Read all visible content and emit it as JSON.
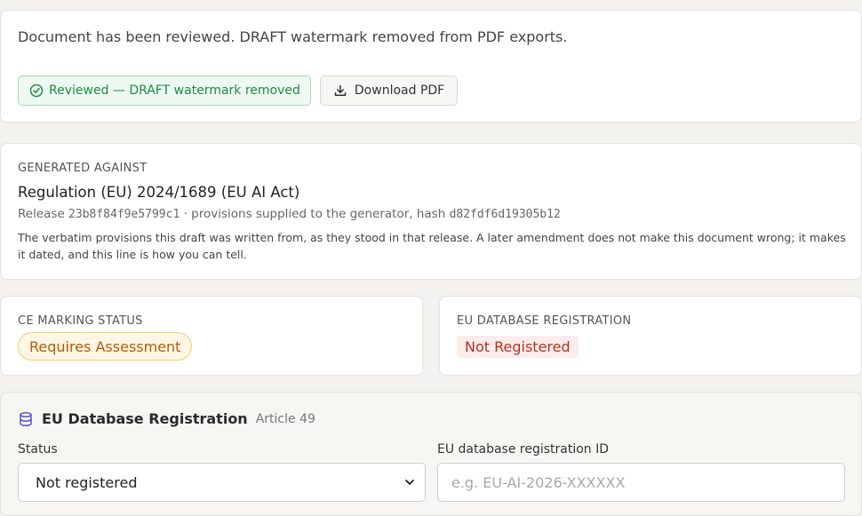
{
  "review": {
    "message": "Document has been reviewed. DRAFT watermark removed from PDF exports.",
    "reviewed_label": "Reviewed — DRAFT watermark removed",
    "download_label": "Download PDF"
  },
  "generated": {
    "eyebrow": "GENERATED AGAINST",
    "regulation": "Regulation (EU) 2024/1689 (EU AI Act)",
    "release_prefix": "Release",
    "release_hash": "23b8f84f9e5799c1",
    "provisions_text": "· provisions supplied to the generator, hash",
    "provisions_hash": "d82fdf6d19305b12",
    "verbatim": "The verbatim provisions this draft was written from, as they stood in that release. A later amendment does not make this document wrong; it makes it dated, and this line is how you can tell."
  },
  "ce_marking": {
    "eyebrow": "CE MARKING STATUS",
    "status": "Requires Assessment"
  },
  "eu_database": {
    "eyebrow": "EU DATABASE REGISTRATION",
    "status": "Not Registered"
  },
  "registration": {
    "title": "EU Database Registration",
    "article": "Article 49",
    "status_label": "Status",
    "status_value": "Not registered",
    "id_label": "EU database registration ID",
    "id_placeholder": "e.g. EU-AI-2026-XXXXXX",
    "id_value": ""
  },
  "colors": {
    "success": "#1f8a45",
    "warning": "#b75a0a",
    "danger": "#b8321d",
    "accent_icon": "#4b47c9"
  },
  "icons": {
    "reviewed": "check-circle-icon",
    "download": "download-icon",
    "database": "database-icon",
    "select_arrow": "chevron-down-icon"
  }
}
